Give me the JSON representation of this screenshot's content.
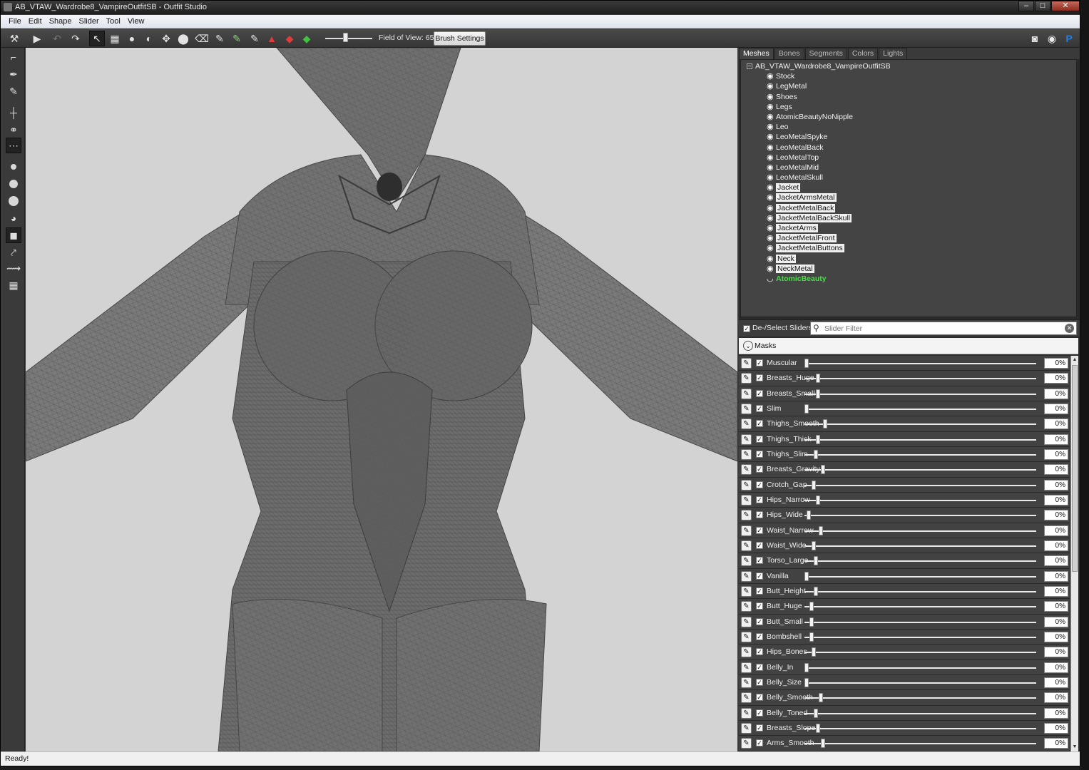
{
  "window": {
    "title": "AB_VTAW_Wardrobe8_VampireOutfitSB - Outfit Studio",
    "controls": [
      "–",
      "□",
      "✕"
    ]
  },
  "menu": [
    "File",
    "Edit",
    "Shape",
    "Slider",
    "Tool",
    "View"
  ],
  "toolbar": {
    "fov_label": "Field of View: 65",
    "brush_settings": "Brush Settings",
    "fov_value": 65
  },
  "tabs": [
    "Meshes",
    "Bones",
    "Segments",
    "Colors",
    "Lights"
  ],
  "active_tab": "Meshes",
  "tree": {
    "root": "AB_VTAW_Wardrobe8_VampireOutfitSB",
    "items": [
      {
        "label": "Stock",
        "style": "normal"
      },
      {
        "label": "LegMetal",
        "style": "normal"
      },
      {
        "label": "Shoes",
        "style": "normal"
      },
      {
        "label": "Legs",
        "style": "normal"
      },
      {
        "label": "AtomicBeautyNoNipple",
        "style": "normal"
      },
      {
        "label": "Leo",
        "style": "normal"
      },
      {
        "label": "LeoMetalSpyke",
        "style": "normal"
      },
      {
        "label": "LeoMetalBack",
        "style": "normal"
      },
      {
        "label": "LeoMetalTop",
        "style": "normal"
      },
      {
        "label": "LeoMetalMid",
        "style": "normal"
      },
      {
        "label": "LeoMetalSkull",
        "style": "normal"
      },
      {
        "label": "Jacket",
        "style": "selected"
      },
      {
        "label": "JacketArmsMetal",
        "style": "selected"
      },
      {
        "label": "JacketMetalBack",
        "style": "selected"
      },
      {
        "label": "JacketMetalBackSkull",
        "style": "selected"
      },
      {
        "label": "JacketArms",
        "style": "selected"
      },
      {
        "label": "JacketMetalFront",
        "style": "selected"
      },
      {
        "label": "JacketMetalButtons",
        "style": "selected"
      },
      {
        "label": "Neck",
        "style": "selected"
      },
      {
        "label": "NeckMetal",
        "style": "selected"
      },
      {
        "label": "AtomicBeauty",
        "style": "active"
      }
    ]
  },
  "slider_panel": {
    "deselect_label": "De-/Select Sliders",
    "filter_placeholder": "Slider Filter",
    "masks_label": "Masks",
    "sliders": [
      {
        "name": "Muscular",
        "value": "0%",
        "pos": 0.0
      },
      {
        "name": "Breasts_Huge",
        "value": "0%",
        "pos": 0.05
      },
      {
        "name": "Breasts_Small",
        "value": "0%",
        "pos": 0.05
      },
      {
        "name": "Slim",
        "value": "0%",
        "pos": 0.0
      },
      {
        "name": "Thighs_Smooth",
        "value": "0%",
        "pos": 0.08
      },
      {
        "name": "Thighs_Thick",
        "value": "0%",
        "pos": 0.05
      },
      {
        "name": "Thighs_Slim",
        "value": "0%",
        "pos": 0.04
      },
      {
        "name": "Breasts_Gravity",
        "value": "0%",
        "pos": 0.07
      },
      {
        "name": "Crotch_Gap",
        "value": "0%",
        "pos": 0.03
      },
      {
        "name": "Hips_Narrow",
        "value": "0%",
        "pos": 0.05
      },
      {
        "name": "Hips_Wide",
        "value": "0%",
        "pos": 0.01
      },
      {
        "name": "Waist_Narrow",
        "value": "0%",
        "pos": 0.06
      },
      {
        "name": "Waist_Wide",
        "value": "0%",
        "pos": 0.03
      },
      {
        "name": "Torso_Large",
        "value": "0%",
        "pos": 0.04
      },
      {
        "name": "Vanilla",
        "value": "0%",
        "pos": 0.0
      },
      {
        "name": "Butt_Height",
        "value": "0%",
        "pos": 0.04
      },
      {
        "name": "Butt_Huge",
        "value": "0%",
        "pos": 0.02
      },
      {
        "name": "Butt_Small",
        "value": "0%",
        "pos": 0.02
      },
      {
        "name": "Bombshell",
        "value": "0%",
        "pos": 0.02
      },
      {
        "name": "Hips_Bones",
        "value": "0%",
        "pos": 0.03
      },
      {
        "name": "Belly_In",
        "value": "0%",
        "pos": 0.0
      },
      {
        "name": "Belly_Size",
        "value": "0%",
        "pos": 0.0
      },
      {
        "name": "Belly_Smooth",
        "value": "0%",
        "pos": 0.06
      },
      {
        "name": "Belly_Toned",
        "value": "0%",
        "pos": 0.04
      },
      {
        "name": "Breasts_Slope",
        "value": "0%",
        "pos": 0.05
      },
      {
        "name": "Arms_Smooth",
        "value": "0%",
        "pos": 0.07
      }
    ]
  },
  "status": "Ready!",
  "colors": {
    "active_mesh": "#3fe33f",
    "viewport_bg": "#d3d3d3",
    "panel_bg": "#444444"
  }
}
